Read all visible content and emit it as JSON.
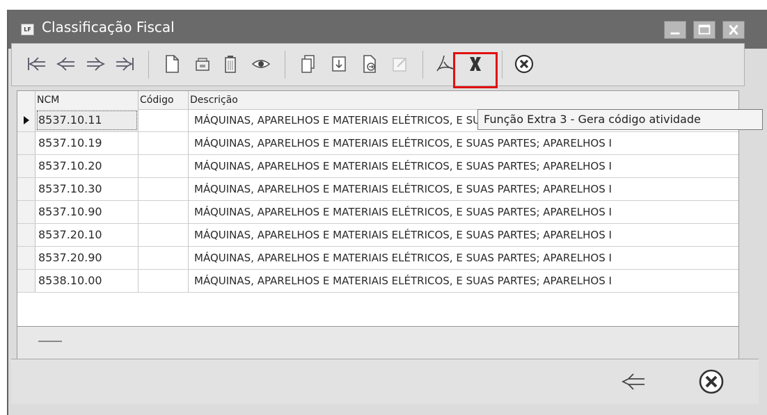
{
  "window": {
    "title": "Classificação Fiscal",
    "app_icon_label": "LF"
  },
  "toolbar": {
    "buttons": [
      {
        "name": "first-record-button",
        "icon": "first-arrow-icon"
      },
      {
        "name": "previous-record-button",
        "icon": "left-arrow-icon"
      },
      {
        "name": "next-record-button",
        "icon": "right-arrow-icon"
      },
      {
        "name": "last-record-button",
        "icon": "last-arrow-icon"
      },
      {
        "name": "new-button",
        "icon": "new-document-icon"
      },
      {
        "name": "edit-button",
        "icon": "edit-icon"
      },
      {
        "name": "delete-button",
        "icon": "trash-icon"
      },
      {
        "name": "view-button",
        "icon": "eye-icon"
      },
      {
        "name": "copy-button",
        "icon": "copy-icon"
      },
      {
        "name": "import-button",
        "icon": "import-icon"
      },
      {
        "name": "extra-function-3-button",
        "icon": "document-arrow-icon"
      },
      {
        "name": "disabled-edit-button",
        "icon": "edit-disabled-icon"
      },
      {
        "name": "pdf-button",
        "icon": "pdf-icon"
      },
      {
        "name": "excel-button",
        "icon": "excel-icon"
      },
      {
        "name": "close-button",
        "icon": "cancel-circle-icon"
      }
    ]
  },
  "tooltip": {
    "text": "Função Extra 3 - Gera código atividade"
  },
  "grid": {
    "columns": [
      "NCM",
      "Código",
      "Descrição"
    ],
    "rows": [
      {
        "ncm": "8537.10.11",
        "codigo": "",
        "descricao": "MÁQUINAS, APARELHOS E MATERIAIS ELÉTRICOS, E SUAS PARTES; APARELHOS I"
      },
      {
        "ncm": "8537.10.19",
        "codigo": "",
        "descricao": "MÁQUINAS, APARELHOS E MATERIAIS ELÉTRICOS, E SUAS PARTES; APARELHOS I"
      },
      {
        "ncm": "8537.10.20",
        "codigo": "",
        "descricao": "MÁQUINAS, APARELHOS E MATERIAIS ELÉTRICOS, E SUAS PARTES; APARELHOS I"
      },
      {
        "ncm": "8537.10.30",
        "codigo": "",
        "descricao": "MÁQUINAS, APARELHOS E MATERIAIS ELÉTRICOS, E SUAS PARTES; APARELHOS I"
      },
      {
        "ncm": "8537.10.90",
        "codigo": "",
        "descricao": "MÁQUINAS, APARELHOS E MATERIAIS ELÉTRICOS, E SUAS PARTES; APARELHOS I"
      },
      {
        "ncm": "8537.20.10",
        "codigo": "",
        "descricao": "MÁQUINAS, APARELHOS E MATERIAIS ELÉTRICOS, E SUAS PARTES; APARELHOS I"
      },
      {
        "ncm": "8537.20.90",
        "codigo": "",
        "descricao": "MÁQUINAS, APARELHOS E MATERIAIS ELÉTRICOS, E SUAS PARTES; APARELHOS I"
      },
      {
        "ncm": "8538.10.00",
        "codigo": "",
        "descricao": "MÁQUINAS, APARELHOS E MATERIAIS ELÉTRICOS, E SUAS PARTES; APARELHOS I"
      }
    ]
  },
  "footer": {
    "buttons": [
      {
        "name": "back-button",
        "icon": "left-arrow-icon"
      },
      {
        "name": "cancel-button",
        "icon": "cancel-circle-icon"
      }
    ]
  },
  "colors": {
    "titlebar": "#6a6a6a",
    "highlight": "#e01010"
  }
}
